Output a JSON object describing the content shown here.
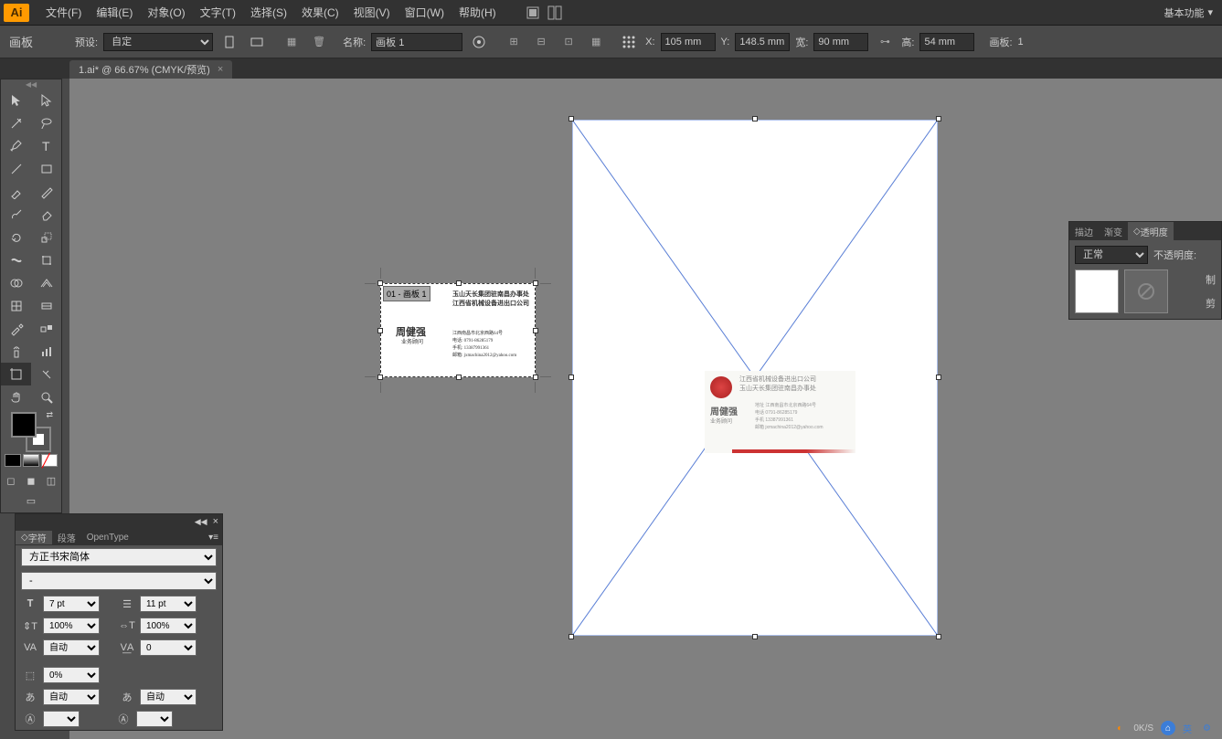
{
  "app": {
    "logo": "Ai",
    "workspace": "基本功能"
  },
  "menu": [
    "文件(F)",
    "编辑(E)",
    "对象(O)",
    "文字(T)",
    "选择(S)",
    "效果(C)",
    "视图(V)",
    "窗口(W)",
    "帮助(H)"
  ],
  "control": {
    "mode": "画板",
    "preset_label": "预设:",
    "preset_value": "自定",
    "name_label": "名称:",
    "name_value": "画板 1",
    "x_label": "X:",
    "x_value": "105 mm",
    "y_label": "Y:",
    "y_value": "148.5 mm",
    "w_label": "宽:",
    "w_value": "90 mm",
    "h_label": "高:",
    "h_value": "54 mm",
    "artboard_label": "画板:",
    "artboard_value": "1"
  },
  "doc_tab": {
    "title": "1.ai* @ 66.67% (CMYK/预览)"
  },
  "artboard_small": {
    "label": "01 - 画板 1",
    "line1": "玉山天长集团驻南昌办事处",
    "line2": "江西省机械设备进出口公司",
    "name": "周健强",
    "title": "业务顾问",
    "addr": "江西南昌市北京西路64号",
    "tel": "电话: 0791-86285179",
    "mob": "手机: 13387991361",
    "email": "邮箱: jxmachina2012@yahoo.com"
  },
  "transparency": {
    "tabs": [
      "描边",
      "渐变",
      "透明度"
    ],
    "blend": "正常",
    "opacity_label": "不透明度:",
    "make_label": "制"
  },
  "character": {
    "tabs": [
      "字符",
      "段落",
      "OpenType"
    ],
    "font": "方正书宋简体",
    "style": "-",
    "size": "7 pt",
    "leading": "11 pt",
    "hscale": "100%",
    "vscale": "100%",
    "kerning": "自动",
    "tracking": "0",
    "baseline": "0%",
    "tsume": "自动"
  },
  "taskbar": {
    "speed": "0K/S",
    "lang": "英"
  }
}
